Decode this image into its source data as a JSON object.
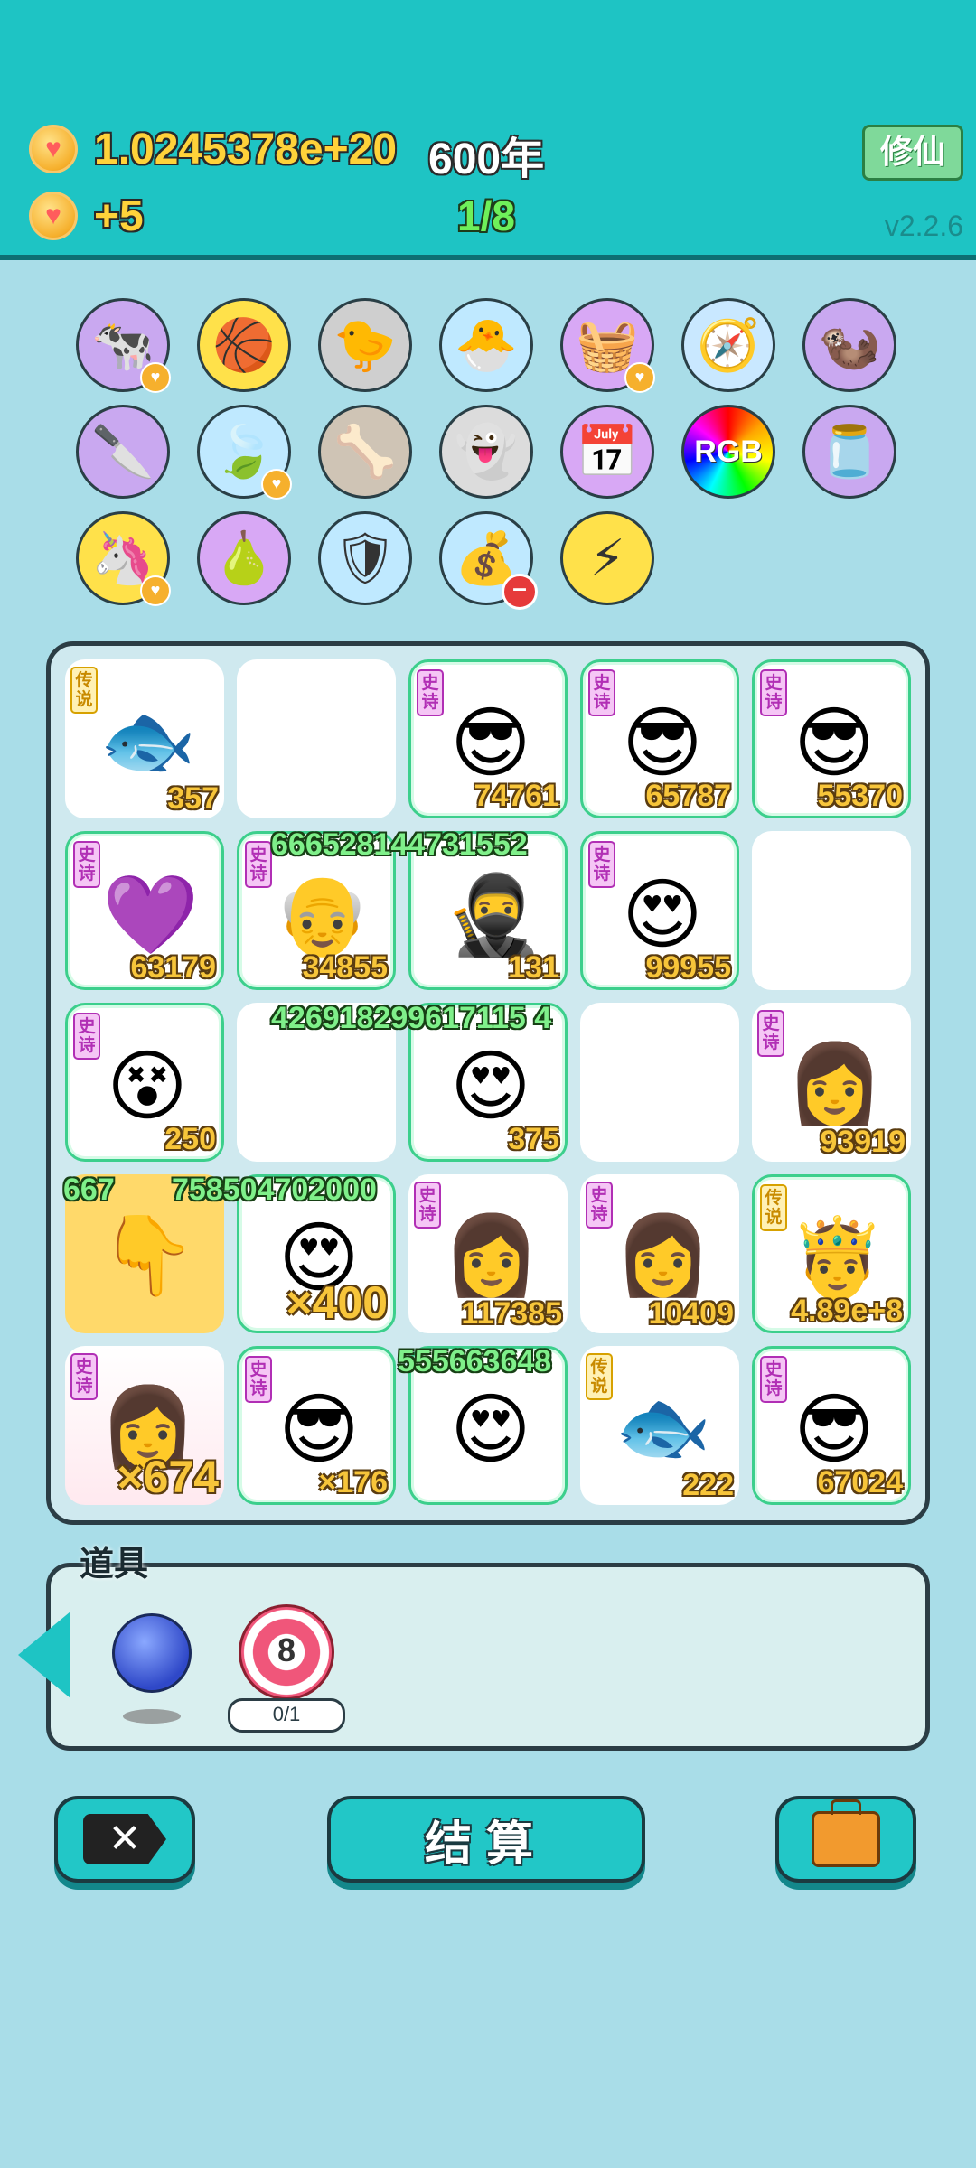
{
  "header": {
    "coins": "1.0245378e+20",
    "year": "600年",
    "income": "+5",
    "progress": "1/8",
    "xiuxian_label": "修仙",
    "version": "v2.2.6"
  },
  "items": [
    {
      "name": "cows-icon",
      "glyph": "🐄",
      "bg": "#c9a8f0",
      "heart": true
    },
    {
      "name": "basketballs-icon",
      "glyph": "🏀",
      "bg": "#ffe14a"
    },
    {
      "name": "duck-pot-icon",
      "glyph": "🐤",
      "bg": "#cfcfcf"
    },
    {
      "name": "chick-egg-icon",
      "glyph": "🐣",
      "bg": "#bfe9ff"
    },
    {
      "name": "fruit-basket-icon",
      "glyph": "🧺",
      "bg": "#d8a8f5",
      "heart": true
    },
    {
      "name": "compass-icon",
      "glyph": "🧭",
      "bg": "#c9e8ff"
    },
    {
      "name": "meerkats-icon",
      "glyph": "🦦",
      "bg": "#c9a8f0"
    },
    {
      "name": "cleaver-icon",
      "glyph": "🔪",
      "bg": "#c9a8f0"
    },
    {
      "name": "leaf-icon",
      "glyph": "🍃",
      "bg": "#bfe9ff",
      "heart": true
    },
    {
      "name": "pet-food-icon",
      "glyph": "🦴",
      "bg": "#cfc4b5"
    },
    {
      "name": "ghost-icon",
      "glyph": "👻",
      "bg": "#dcdcdc"
    },
    {
      "name": "calendar-icon",
      "glyph": "📅",
      "bg": "#d8a8f5"
    },
    {
      "name": "rgb-icon",
      "glyph": "RGB",
      "bg": "conic-gradient(red,orange,yellow,lime,cyan,blue,magenta,red)"
    },
    {
      "name": "jar-icon",
      "glyph": "🫙",
      "bg": "#c9a8f0"
    },
    {
      "name": "unicorn-icon",
      "glyph": "🦄",
      "bg": "#ffe14a",
      "heart": true
    },
    {
      "name": "pomelo-icon",
      "glyph": "🍐",
      "bg": "#d8a8f5"
    },
    {
      "name": "shield-wrench-icon",
      "glyph": "🛡",
      "bg": "#bfe9ff"
    },
    {
      "name": "sack-icon",
      "glyph": "💰",
      "bg": "#bfe9ff",
      "minus": true
    },
    {
      "name": "lightning-icon",
      "glyph": "⚡",
      "bg": "#ffe14a"
    }
  ],
  "board": [
    [
      {
        "tag": "传说",
        "tagType": "legend",
        "face": "🐟",
        "value": "357"
      },
      {
        "empty": true
      },
      {
        "tag": "史诗",
        "tagType": "epic",
        "face": "😎",
        "value": "74761",
        "epic": true
      },
      {
        "tag": "史诗",
        "tagType": "epic",
        "face": "😎",
        "value": "65787",
        "epic": true
      },
      {
        "tag": "史诗",
        "tagType": "epic",
        "face": "😎",
        "value": "55370",
        "epic": true
      }
    ],
    [
      {
        "tag": "史诗",
        "tagType": "epic",
        "face": "💜",
        "value": "63179",
        "epic": true
      },
      {
        "tag": "史诗",
        "tagType": "epic",
        "face": "👴",
        "value": "34855",
        "epic": true
      },
      {
        "face": "🥷",
        "value": "131",
        "epic": true
      },
      {
        "tag": "史诗",
        "tagType": "epic",
        "face": "😍",
        "value": "99955",
        "epic": true
      },
      {
        "empty": true
      }
    ],
    [
      {
        "tag": "史诗",
        "tagType": "epic",
        "face": "😵",
        "value": "250",
        "epic": true
      },
      {
        "empty": true
      },
      {
        "face": "😍",
        "value": "375",
        "epic": true
      },
      {
        "empty": true
      },
      {
        "tag": "史诗",
        "tagType": "epic",
        "face": "👩",
        "value": "93919"
      }
    ],
    [
      {
        "face": "👇",
        "value": "",
        "yellow": true
      },
      {
        "face": "😍",
        "value": "×400",
        "epic": true,
        "big": true
      },
      {
        "tag": "史诗",
        "tagType": "epic",
        "face": "👩",
        "value": "117385"
      },
      {
        "tag": "史诗",
        "tagType": "epic",
        "face": "👩",
        "value": "10409"
      },
      {
        "tag": "传说",
        "tagType": "legend",
        "face": "🤴",
        "value": "4.89e+8",
        "epic": true
      }
    ],
    [
      {
        "tag": "史诗",
        "tagType": "epic",
        "face": "👩",
        "value": "×674",
        "big": true,
        "pink": true
      },
      {
        "tag": "史诗",
        "tagType": "epic",
        "face": "😎",
        "value": "×176",
        "epic": true
      },
      {
        "face": "😍",
        "value": "",
        "epic": true
      },
      {
        "tag": "传说",
        "tagType": "legend",
        "face": "🐟",
        "value": "222"
      },
      {
        "tag": "史诗",
        "tagType": "epic",
        "face": "😎",
        "value": "67024",
        "epic": true
      }
    ]
  ],
  "floating": {
    "f1": "666528144731552",
    "f2": "426918299617115 4",
    "f3": "667",
    "f4": "758504702000",
    "f5": "555663648"
  },
  "tools": {
    "title": "道具",
    "target_value": "8",
    "target_count": "0/1"
  },
  "buttons": {
    "close_glyph": "✕",
    "settle_label": "结算"
  }
}
